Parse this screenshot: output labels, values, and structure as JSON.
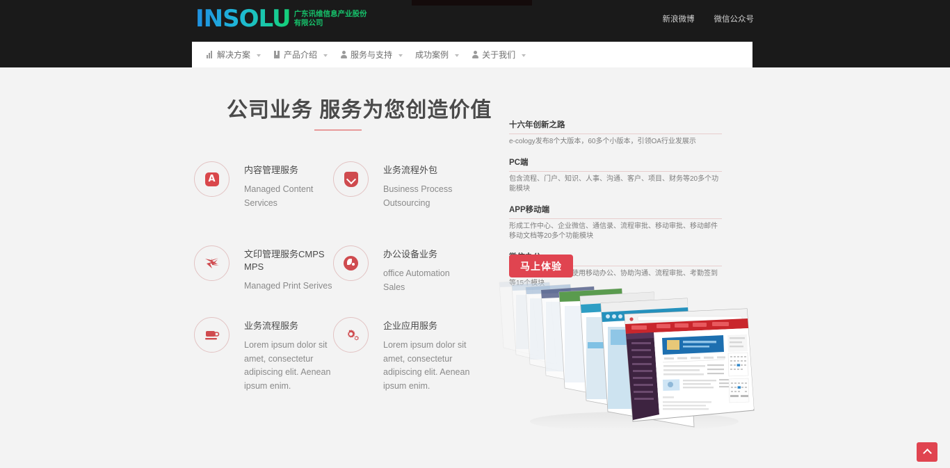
{
  "header": {
    "logo_mark": "INSOLU",
    "logo_cn": "广东讯维信息产业股份\n有限公司",
    "social": [
      {
        "label": "新浪微博",
        "icon": "weibo-icon"
      },
      {
        "label": "微信公众号",
        "icon": "wechat-icon"
      }
    ],
    "nav": [
      {
        "label": "解决方案",
        "icon": "chart-icon",
        "caret": true
      },
      {
        "label": "产品介绍",
        "icon": "book-icon",
        "caret": true
      },
      {
        "label": "服务与支持",
        "icon": "person-icon",
        "caret": true
      },
      {
        "label": "成功案例",
        "icon": "none",
        "caret": true
      },
      {
        "label": "关于我们",
        "icon": "person-icon",
        "caret": true
      }
    ]
  },
  "main": {
    "headline": "公司业务 服务为您创造价值",
    "services": [
      {
        "icon": "letter-a-icon",
        "title": "内容管理服务",
        "desc": "Managed Content Services"
      },
      {
        "icon": "shield-chevron-down-icon",
        "title": "业务流程外包",
        "desc": "Business Process Outsourcing"
      },
      {
        "icon": "bowtie-print-icon",
        "title": "文印管理服务CMPS MPS",
        "desc": "Managed Print Serives"
      },
      {
        "icon": "globe-icon",
        "title": "办公设备业务",
        "desc": "office Automation Sales"
      },
      {
        "icon": "cup-icon",
        "title": "业务流程服务",
        "desc": "Lorem ipsum dolor sit amet, consectetur adipiscing elit. Aenean ipsum enim."
      },
      {
        "icon": "gears-icon",
        "title": "企业应用服务",
        "desc": "Lorem ipsum dolor sit amet, consectetur adipiscing elit. Aenean ipsum enim."
      }
    ]
  },
  "panel": {
    "features": [
      {
        "title": "十六年创新之路",
        "desc": "e-cology发布8个大版本，60多个小版本，引领OA行业发展示"
      },
      {
        "title": "PC端",
        "desc": "包含流程、门户、知识、人事、沟通、客户、项目、财务等20多个功能模块"
      },
      {
        "title": "APP移动端",
        "desc": "形成工作中心、企业微信、通信录、流程审批、移动审批、移动邮件移动文档等20多个功能模块"
      },
      {
        "title": "微信办公",
        "desc": "在微信中可以方便的使用移动办公、协助沟通、流程审批、考勤签到等15个模块"
      }
    ],
    "cta_label": "马上体验",
    "screenshot_stack_alt": "product-screenshot-stack"
  },
  "back_to_top": {
    "icon": "chevron-up-icon",
    "label": ""
  },
  "colors": {
    "header_bg": "#1a1a1a",
    "body_bg": "#f3f3f3",
    "accent_red": "#e04450",
    "icon_red": "#cf4b4f",
    "circle_border": "#e2c3c3",
    "rule_pink": "#e79a9a",
    "logo_blue": "#1f8fe0",
    "logo_green": "#14cf74"
  }
}
